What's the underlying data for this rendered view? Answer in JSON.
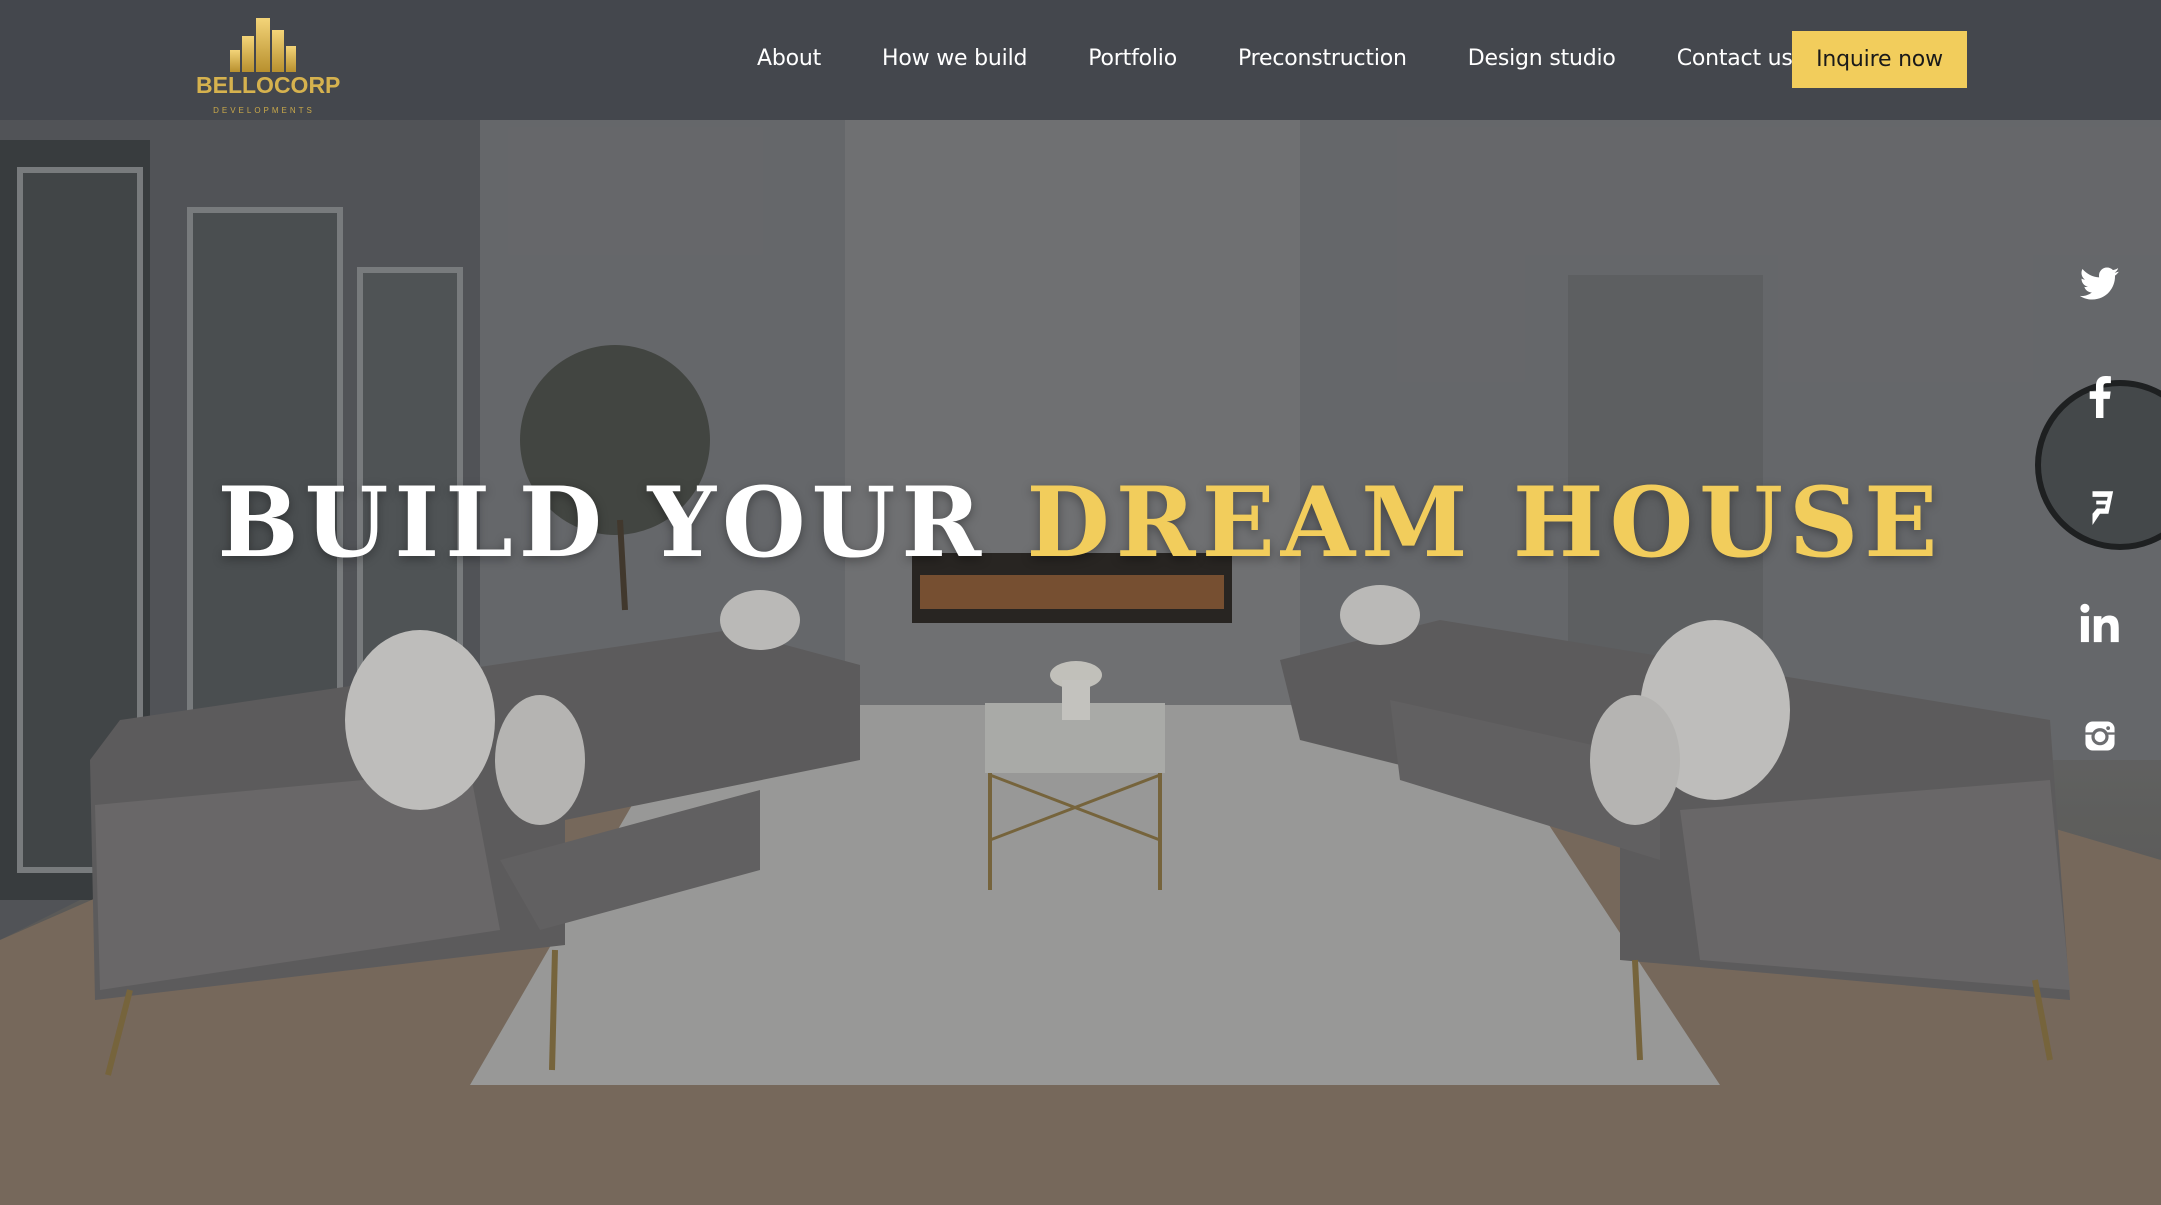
{
  "brand": {
    "name": "BELLOCORP",
    "sub": "DEVELOPMENTS"
  },
  "nav": {
    "items": [
      "About",
      "How we build",
      "Portfolio",
      "Preconstruction",
      "Design studio",
      "Contact us"
    ],
    "cta_label": "Inquire now"
  },
  "hero": {
    "headline_part1": "BUILD YOUR",
    "headline_part2": "DREAM HOUSE"
  },
  "social": [
    "twitter-icon",
    "facebook-icon",
    "foursquare-icon",
    "linkedin-icon",
    "instagram-icon"
  ],
  "colors": {
    "accent": "#f2cd5c",
    "header_bg": "#373c43",
    "text_light": "#ffffff"
  }
}
